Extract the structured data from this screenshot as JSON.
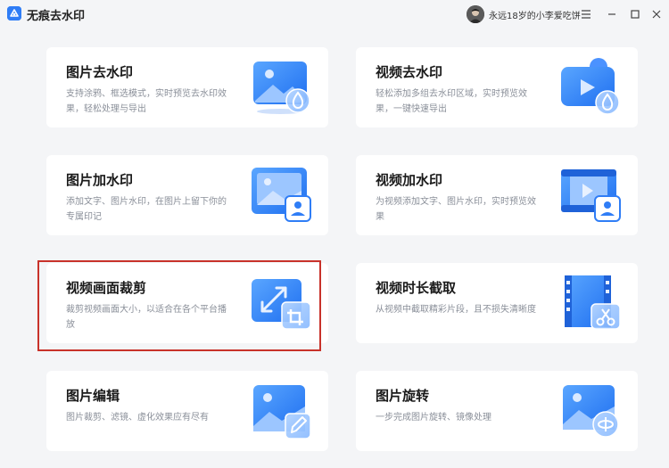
{
  "app": {
    "title": "无痕去水印",
    "user": "永远18岁的小李爱吃饼"
  },
  "icons": {
    "logo": "app-logo-icon",
    "menu": "hamburger-menu-icon",
    "minimize": "minimize-icon",
    "maximize": "maximize-icon",
    "close": "close-icon"
  },
  "colors": {
    "accent": "#2f7df6",
    "background": "#f4f5f7",
    "selection": "#c8322a"
  },
  "cards": [
    {
      "title": "图片去水印",
      "desc": "支持涂鸦、框选模式，实时预览去水印效果，轻松处理与导出",
      "icon": "image-remove-watermark-icon"
    },
    {
      "title": "视频去水印",
      "desc": "轻松添加多组去水印区域，实时预览效果，一键快速导出",
      "icon": "video-remove-watermark-icon"
    },
    {
      "title": "图片加水印",
      "desc": "添加文字、图片水印，在图片上留下你的专属印记",
      "icon": "image-add-watermark-icon"
    },
    {
      "title": "视频加水印",
      "desc": "为视频添加文字、图片水印，实时预览效果",
      "icon": "video-add-watermark-icon"
    },
    {
      "title": "视频画面裁剪",
      "desc": "裁剪视频画面大小，以适合在各个平台播放",
      "icon": "video-crop-icon",
      "selected": true
    },
    {
      "title": "视频时长截取",
      "desc": "从视频中截取精彩片段，且不损失清晰度",
      "icon": "video-trim-icon"
    },
    {
      "title": "图片编辑",
      "desc": "图片裁剪、滤镜、虚化效果应有尽有",
      "icon": "image-edit-icon"
    },
    {
      "title": "图片旋转",
      "desc": "一步完成图片旋转、镜像处理",
      "icon": "image-rotate-icon"
    }
  ]
}
